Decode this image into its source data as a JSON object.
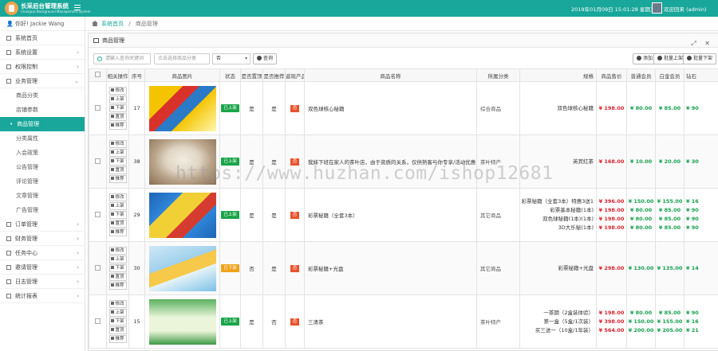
{
  "app": {
    "title": "长采后台管理系统",
    "subtitle": "Changcai Background Management System",
    "datetime": "2019年01月09日 15:01:28  星期三",
    "welcome": "欢迎回来 (admin)"
  },
  "sidebar": {
    "user": "你好! Jackie Wang",
    "items": [
      {
        "label": "系统首页",
        "chevron": ""
      },
      {
        "label": "系统设置",
        "chevron": "›"
      },
      {
        "label": "权限控制",
        "chevron": "›"
      },
      {
        "label": "业务管理",
        "chevron": "⌄"
      }
    ],
    "subitems": [
      {
        "label": "商品分类"
      },
      {
        "label": "店铺参数"
      },
      {
        "label": "商品管理"
      },
      {
        "label": "分类属性"
      },
      {
        "label": "入会政策"
      },
      {
        "label": "公告管理"
      },
      {
        "label": "评论管理"
      },
      {
        "label": "文章管理"
      },
      {
        "label": "广告管理"
      }
    ],
    "items2": [
      {
        "label": "订单管理",
        "chevron": "›"
      },
      {
        "label": "财务管理",
        "chevron": "›"
      },
      {
        "label": "任务中心",
        "chevron": "›"
      },
      {
        "label": "邀请管理",
        "chevron": "›"
      },
      {
        "label": "日志管理",
        "chevron": "›"
      },
      {
        "label": "统计报表",
        "chevron": "›"
      }
    ]
  },
  "breadcrumb": {
    "home": "系统首页",
    "sep": "/",
    "current": "商品管理"
  },
  "panel": {
    "title": "商品管理",
    "controls": "⤢ ✕"
  },
  "toolbar": {
    "search_placeholder": "请输入查询关键词",
    "category_placeholder": "点击选择商品分类",
    "select_value": "否",
    "query_label": "查询",
    "add_label": "添加",
    "batch_up_label": "批量上架",
    "batch_down_label": "批量下架"
  },
  "table": {
    "headers": [
      "",
      "相关操作",
      "序号",
      "商品图片",
      "状态",
      "是否置顶",
      "是否推荐",
      "返现产品",
      "商品名称",
      "所属分类",
      "规格",
      "商品售价",
      "普通会员",
      "白金会员",
      "钻石"
    ],
    "ops": {
      "edit": "修改",
      "up": "上架",
      "down": "下架",
      "top": "置顶",
      "rec": "推荐"
    },
    "rows": [
      {
        "id": "17",
        "status": "已上架",
        "status_on": true,
        "top": "是",
        "rec": "是",
        "cash": "否",
        "name": "双色球核心秘籍",
        "category": "综合商品",
        "specs": [
          "双色球核心秘籍"
        ],
        "prices": [
          "¥ 198.00"
        ],
        "normal": [
          "¥ 80.00"
        ],
        "gold": [
          "¥ 85.00"
        ],
        "diamond": [
          "¥ 90"
        ]
      },
      {
        "id": "38",
        "status": "已上架",
        "status_on": true,
        "top": "是",
        "rec": "是",
        "cash": "否",
        "name": "我妹下班在家人的茶叶店，由于资质的关系，仅供熟客与你专享/活动优惠",
        "category": "茶叶特产",
        "specs": [
          "英宾红茶"
        ],
        "prices": [
          "¥ 168.00"
        ],
        "normal": [
          "¥ 10.00"
        ],
        "gold": [
          "¥ 20.00"
        ],
        "diamond": [
          "¥ 30"
        ]
      },
      {
        "id": "29",
        "status": "已上架",
        "status_on": true,
        "top": "是",
        "rec": "是",
        "cash": "否",
        "name": "彩票秘籍（全套3本）",
        "category": "其它商品",
        "specs": [
          "彩票秘籍（全套3本）特惠3送1",
          "彩票基本秘籍(1本)",
          "双色球秘籍(1本)(1本)",
          "3D大乐秘(1本)"
        ],
        "prices": [
          "¥ 396.00",
          "¥ 198.00",
          "¥ 198.00",
          "¥ 198.00"
        ],
        "normal": [
          "¥ 150.00",
          "¥ 80.00",
          "¥ 80.00",
          "¥ 80.00"
        ],
        "gold": [
          "¥ 155.00",
          "¥ 85.00",
          "¥ 85.00",
          "¥ 85.00"
        ],
        "diamond": [
          "¥ 16",
          "¥ 90",
          "¥ 90",
          "¥ 90"
        ]
      },
      {
        "id": "30",
        "status": "已下架",
        "status_on": false,
        "top": "否",
        "rec": "是",
        "cash": "否",
        "name": "彩票秘籍+光盘",
        "category": "其它商品",
        "specs": [
          "彩票秘籍+光盘"
        ],
        "prices": [
          "¥ 298.00"
        ],
        "normal": [
          "¥ 130.00"
        ],
        "gold": [
          "¥ 135.00"
        ],
        "diamond": [
          "¥ 14"
        ]
      },
      {
        "id": "15",
        "status": "已上架",
        "status_on": true,
        "top": "是",
        "rec": "否",
        "cash": "否",
        "name": "三清茶",
        "category": "茶叶特产",
        "specs": [
          "一茶期（2盒装体验）",
          "第一盒（5盒/1次装）",
          "买三送一（10盒/1年装）"
        ],
        "prices": [
          "¥ 198.00",
          "¥ 398.00",
          "¥ 564.00"
        ],
        "normal": [
          "¥ 80.00",
          "¥ 150.00",
          "¥ 200.00"
        ],
        "gold": [
          "¥ 85.00",
          "¥ 155.00",
          "¥ 205.00"
        ],
        "diamond": [
          "¥ 90",
          "¥ 16",
          "¥ 21"
        ]
      }
    ]
  },
  "watermark": "https://www.huzhan.com/ishop12681",
  "colors": {
    "brand": "#18a79a",
    "price": "#d9232e",
    "onshelf": "#1aa54a",
    "offshelf": "#f0a21b"
  }
}
